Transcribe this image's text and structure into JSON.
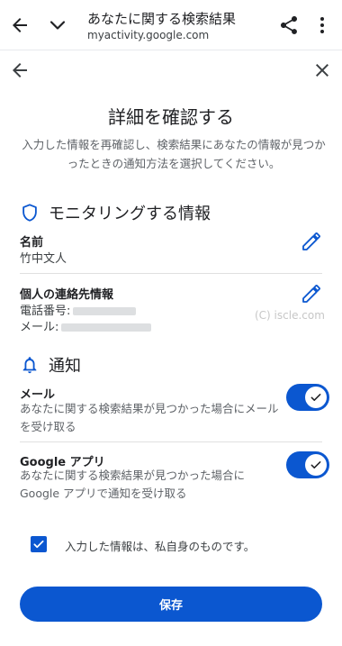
{
  "browser": {
    "title": "あなたに関する検索結果",
    "url": "myactivity.google.com"
  },
  "page": {
    "title": "詳細を確認する",
    "intro": "入力した情報を再確認し、検索結果にあなたの情報が見つかったときの通知方法を選択してください。"
  },
  "monitoring": {
    "heading": "モニタリングする情報",
    "name_label": "名前",
    "name_value": "竹中文人",
    "contact_label": "個人の連絡先情報",
    "phone_label": "電話番号:",
    "email_label": "メール:"
  },
  "watermark": "(C) iscle.com",
  "notifications": {
    "heading": "通知",
    "email": {
      "label": "メール",
      "desc": "あなたに関する検索結果が見つかった場合にメールを受け取る",
      "enabled": true
    },
    "app": {
      "label": "Google アプリ",
      "desc": "あなたに関する検索結果が見つかった場合に Google アプリで通知を受け取る",
      "enabled": true
    }
  },
  "consent": {
    "text": "入力した情報は、私自身のものです。",
    "checked": true
  },
  "save_label": "保存",
  "colors": {
    "accent": "#0b57d0"
  },
  "icons": {
    "browser_back": "arrow-back-icon",
    "browser_collapse": "chevron-down-icon",
    "share": "share-icon",
    "more": "more-vert-icon",
    "page_back": "arrow-back-icon",
    "close": "close-icon",
    "monitoring": "shield-icon",
    "edit": "pencil-icon",
    "notifications": "bell-icon",
    "toggle_on": "check-icon"
  }
}
